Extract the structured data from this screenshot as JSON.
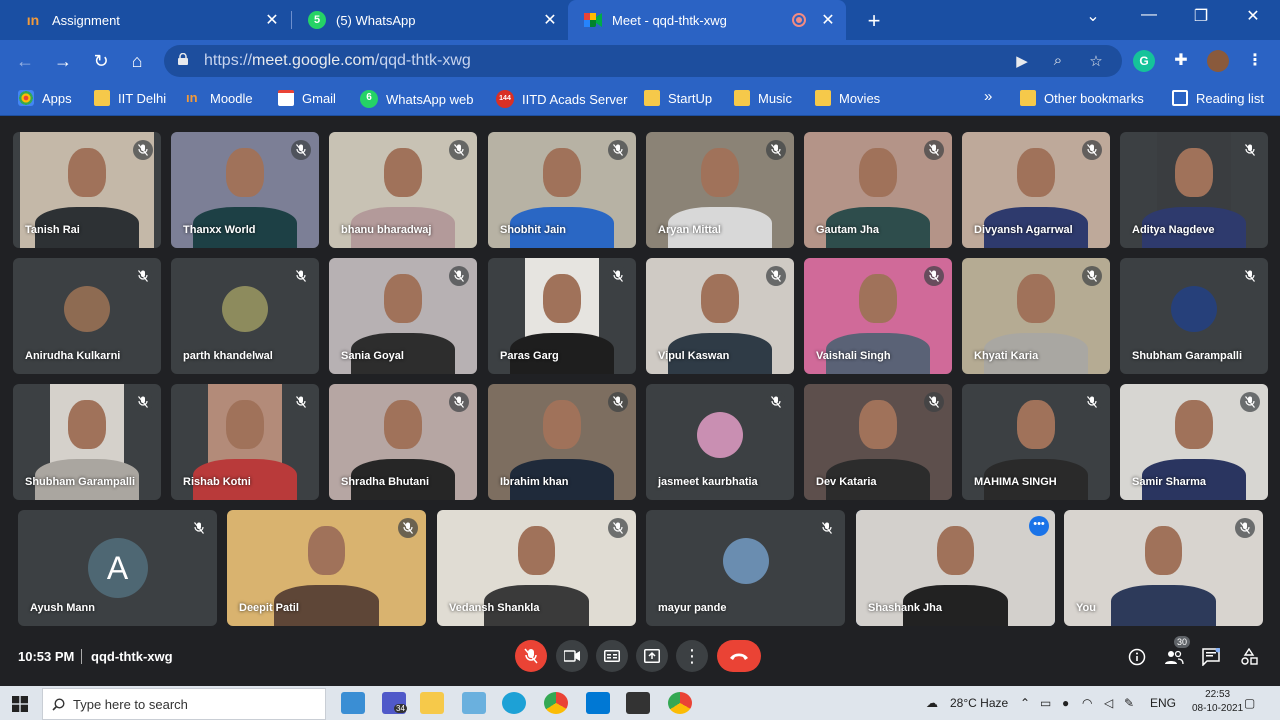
{
  "browser": {
    "tabs": [
      {
        "title": "Assignment",
        "active": false
      },
      {
        "title": "(5) WhatsApp",
        "active": false,
        "badge": "5"
      },
      {
        "title": "Meet - qqd-thtk-xwg",
        "active": true
      }
    ],
    "url_prefix": "https://",
    "url_host": "meet.google.com",
    "url_path": "/qqd-thtk-xwg",
    "profile_ext": "G"
  },
  "bookmarks": {
    "items": [
      "Apps",
      "IIT Delhi",
      "Moodle",
      "Gmail",
      "WhatsApp web",
      "IITD Acads Server",
      "StartUp",
      "Music",
      "Movies"
    ],
    "whatsapp_badge": "6",
    "iitd_badge": "144",
    "overflow": "»",
    "other": "Other bookmarks",
    "reading_list": "Reading list"
  },
  "participants": [
    "Tanish Rai",
    "Thanxx World",
    "bhanu bharadwaj",
    "Shobhit Jain",
    "Aryan Mittal",
    "Gautam Jha",
    "Divyansh Agarrwal",
    "Aditya Nagdeve",
    "Anirudha Kulkarni",
    "parth khandelwal",
    "Sania Goyal",
    "Paras Garg",
    "Vipul Kaswan",
    "Vaishali Singh",
    "Khyati Karia",
    "Shubham Garampalli",
    "Shubham Garampalli",
    "Rishab Kotni",
    "Shradha Bhutani",
    "Ibrahim khan",
    "jasmeet kaurbhatia",
    "Dev Kataria",
    "MAHIMA SINGH",
    "Samir Sharma",
    "Ayush Mann",
    "Deepit Patil",
    "Vedansh Shankla",
    "mayur pande",
    "Shashank Jha",
    "You"
  ],
  "ayush_initial": "A",
  "meet": {
    "time": "10:53 PM",
    "code": "qqd-thtk-xwg",
    "people_count": "30"
  },
  "taskbar": {
    "search_placeholder": "Type here to search",
    "teams_badge": "34",
    "weather": "28°C  Haze",
    "lang": "ENG",
    "time": "22:53",
    "date": "08-10-2021"
  },
  "colors": {
    "chrome_blue": "#2b63c4",
    "meet_bg": "#202124",
    "tile_bg": "#3c4043",
    "end_call_red": "#ea4335"
  }
}
